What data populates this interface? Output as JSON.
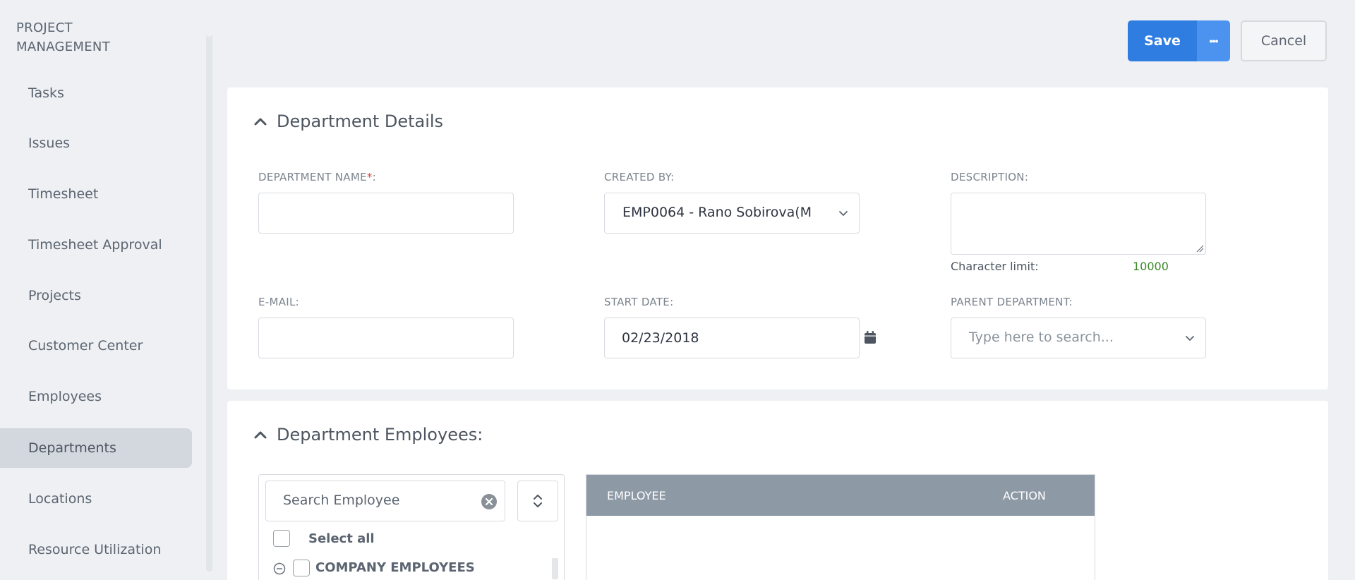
{
  "sidebar": {
    "title_line1": "PROJECT",
    "title_line2": "MANAGEMENT",
    "items": [
      {
        "label": "Tasks"
      },
      {
        "label": "Issues"
      },
      {
        "label": "Timesheet"
      },
      {
        "label": "Timesheet Approval"
      },
      {
        "label": "Projects"
      },
      {
        "label": "Customer Center"
      },
      {
        "label": "Employees"
      },
      {
        "label": "Departments",
        "active": true
      },
      {
        "label": "Locations"
      },
      {
        "label": "Resource Utilization"
      }
    ]
  },
  "toolbar": {
    "save_label": "Save",
    "more_label": "•••",
    "cancel_label": "Cancel"
  },
  "details": {
    "title": "Department Details",
    "department_name": {
      "label": "DEPARTMENT NAME",
      "required_mark": "*",
      "suffix": ":",
      "value": ""
    },
    "created_by": {
      "label": "CREATED BY:",
      "value": "EMP0064 - Rano Sobirova(M"
    },
    "description": {
      "label": "DESCRIPTION:",
      "value": "",
      "char_limit_label": "Character limit:",
      "char_limit_value": "10000"
    },
    "email": {
      "label": "E-MAIL:",
      "value": ""
    },
    "start_date": {
      "label": "START DATE:",
      "value": "02/23/2018"
    },
    "parent_department": {
      "label": "PARENT DEPARTMENT:",
      "placeholder": "Type here to search..."
    }
  },
  "employees": {
    "title": "Department Employees:",
    "search_placeholder": "Search Employee",
    "select_all_label": "Select all",
    "group_label": "COMPANY EMPLOYEES",
    "table_headers": {
      "employee": "EMPLOYEE",
      "action": "ACTION"
    }
  },
  "colors": {
    "primary": "#2f7de1",
    "required": "#e0413a",
    "char_limit": "#3a8a28",
    "table_header": "#8e99a6"
  }
}
